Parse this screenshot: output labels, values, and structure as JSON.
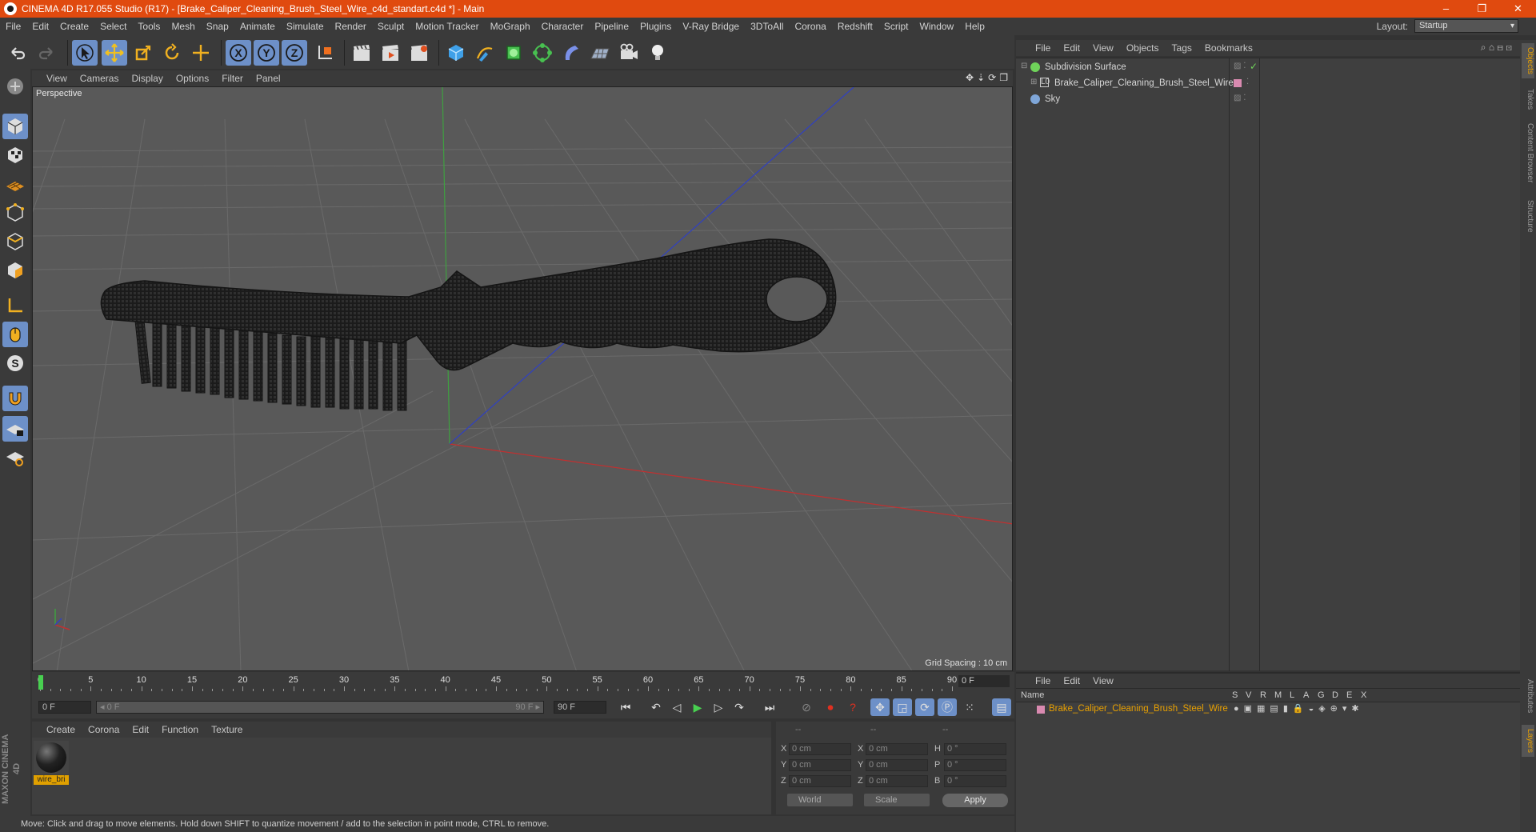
{
  "title_bar": {
    "title": "CINEMA 4D R17.055 Studio (R17) - [Brake_Caliper_Cleaning_Brush_Steel_Wire_c4d_standart.c4d *] - Main",
    "buttons": [
      "–",
      "❐",
      "✕"
    ]
  },
  "menu_bar": {
    "items": [
      "File",
      "Edit",
      "Create",
      "Select",
      "Tools",
      "Mesh",
      "Snap",
      "Animate",
      "Simulate",
      "Render",
      "Sculpt",
      "Motion Tracker",
      "MoGraph",
      "Character",
      "Pipeline",
      "Plugins",
      "V-Ray Bridge",
      "3DToAll",
      "Corona",
      "Redshift",
      "Script",
      "Window",
      "Help"
    ],
    "layout_label": "Layout:",
    "layout_value": "Startup"
  },
  "viewport": {
    "menu": [
      "View",
      "Cameras",
      "Display",
      "Options",
      "Filter",
      "Panel"
    ],
    "label": "Perspective",
    "grid_spacing": "Grid Spacing : 10 cm"
  },
  "timeline": {
    "ticks": [
      "0",
      "5",
      "10",
      "15",
      "20",
      "25",
      "30",
      "35",
      "40",
      "45",
      "50",
      "55",
      "60",
      "65",
      "70",
      "75",
      "80",
      "85",
      "90"
    ],
    "frame_end_display": "0 F",
    "start_field": "0 F",
    "range_start": "◂ 0 F",
    "range_end": "90 F ▸",
    "end_field": "90 F"
  },
  "material_manager": {
    "menu": [
      "Create",
      "Corona",
      "Edit",
      "Function",
      "Texture"
    ],
    "materials": [
      {
        "name": "wire_bri"
      }
    ]
  },
  "coordinates": {
    "headers": [
      "--",
      "--",
      "--"
    ],
    "rows": [
      {
        "a": "X",
        "v1": "0 cm",
        "b": "X",
        "v2": "0 cm",
        "c": "H",
        "v3": "0 °"
      },
      {
        "a": "Y",
        "v1": "0 cm",
        "b": "Y",
        "v2": "0 cm",
        "c": "P",
        "v3": "0 °"
      },
      {
        "a": "Z",
        "v1": "0 cm",
        "b": "Z",
        "v2": "0 cm",
        "c": "B",
        "v3": "0 °"
      }
    ],
    "mode": "World",
    "type": "Scale",
    "apply": "Apply"
  },
  "status_bar": {
    "text": "Move: Click and drag to move elements. Hold down SHIFT to quantize movement / add to the selection in point mode, CTRL to remove."
  },
  "object_manager": {
    "menu": [
      "File",
      "Edit",
      "View",
      "Objects",
      "Tags",
      "Bookmarks"
    ],
    "objects": [
      {
        "name": "Subdivision Surface",
        "color": "#6fd35a"
      },
      {
        "name": "Brake_Caliper_Cleaning_Brush_Steel_Wire",
        "color": "#aaaaaa"
      },
      {
        "name": "Sky",
        "color": "#7fa6d8"
      }
    ]
  },
  "layer_manager": {
    "menu": [
      "File",
      "Edit",
      "View"
    ],
    "columns": [
      "Name",
      "S",
      "V",
      "R",
      "M",
      "L",
      "A",
      "G",
      "D",
      "E",
      "X"
    ],
    "layers": [
      {
        "name": "Brake_Caliper_Cleaning_Brush_Steel_Wire",
        "color": "#d98ab0"
      }
    ]
  },
  "right_tabs": [
    "Objects",
    "Takes",
    "Content Browser",
    "Structure",
    "Attributes",
    "Layers"
  ],
  "branding": "MAXON CINEMA 4D",
  "accent": "#e04a0f",
  "selection_color": "#6d90c8"
}
